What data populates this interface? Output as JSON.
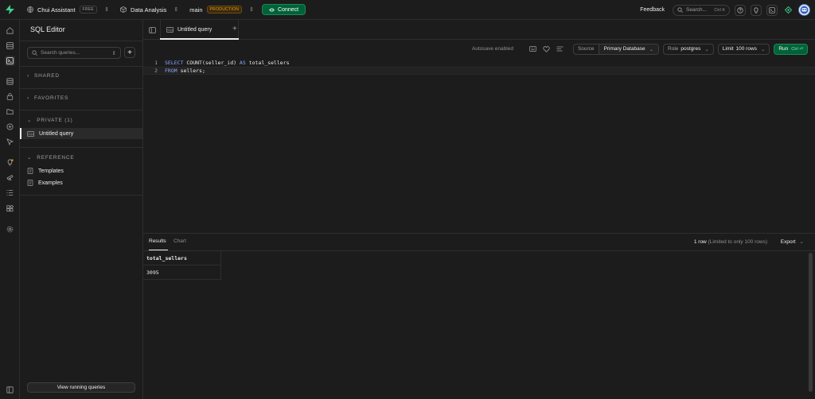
{
  "topbar": {
    "org": "Chui Assistant",
    "org_plan": "FREE",
    "project": "Data Analysis",
    "branch": "main",
    "branch_env": "PRODUCTION",
    "connect_label": "Connect",
    "feedback_label": "Feedback",
    "search_placeholder": "Search...",
    "search_shortcut": "Ctrl K"
  },
  "sidebar": {
    "title": "SQL Editor",
    "search_placeholder": "Search queries...",
    "sections": {
      "shared": "SHARED",
      "favorites": "FAVORITES",
      "private": "PRIVATE (1)",
      "reference": "REFERENCE"
    },
    "private_items": [
      {
        "label": "Untitled query"
      }
    ],
    "reference_items": [
      {
        "label": "Templates"
      },
      {
        "label": "Examples"
      }
    ],
    "view_running_label": "View running queries"
  },
  "tabs": [
    {
      "label": "Untitled query"
    }
  ],
  "toolbar": {
    "autosave": "Autosave enabled",
    "source_label": "Source",
    "source_value": "Primary Database",
    "role_label": "Role",
    "role_value": "postgres",
    "limit_label": "Limit",
    "limit_value": "100 rows",
    "run_label": "Run",
    "run_shortcut": "Ctrl ⏎"
  },
  "editor": {
    "lines": [
      {
        "num": "1",
        "kw1": "SELECT",
        "fn": " COUNT",
        "arg": "(seller_id)",
        "kw2": " AS",
        "rest": " total_sellers"
      },
      {
        "num": "2",
        "kw1": "FROM",
        "rest": " sellers;"
      }
    ]
  },
  "results": {
    "tab_results": "Results",
    "tab_chart": "Chart",
    "row_count": "1 row",
    "row_count_note": " (Limited to only 100 rows)",
    "export_label": "Export",
    "columns": [
      "total_sellers"
    ],
    "rows": [
      [
        "3095"
      ]
    ]
  },
  "colors": {
    "accent_green": "#006239",
    "production_badge": "#f1a10d",
    "keyword": "#8aa4ff"
  }
}
